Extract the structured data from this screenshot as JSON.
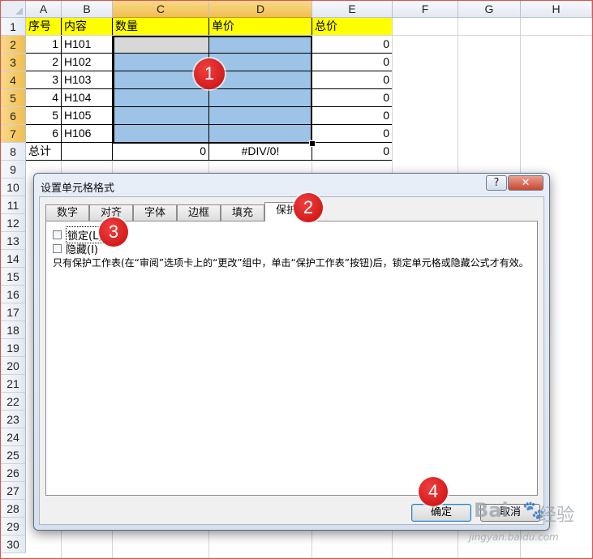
{
  "sheet": {
    "columns": [
      "A",
      "B",
      "C",
      "D",
      "E",
      "F",
      "G",
      "H"
    ],
    "rows": [
      "1",
      "2",
      "3",
      "4",
      "5",
      "6",
      "7",
      "8",
      "9",
      "10",
      "11",
      "12",
      "13",
      "14",
      "15",
      "16",
      "17",
      "18",
      "19",
      "20",
      "21",
      "22",
      "23",
      "24",
      "25",
      "26",
      "27",
      "28",
      "29",
      "30"
    ],
    "header": {
      "a": "序号",
      "b": "内容",
      "c": "数量",
      "d": "单价",
      "e": "总价"
    },
    "data": [
      {
        "a": "1",
        "b": "H101",
        "e": "0"
      },
      {
        "a": "2",
        "b": "H102",
        "e": "0"
      },
      {
        "a": "3",
        "b": "H103",
        "e": "0"
      },
      {
        "a": "4",
        "b": "H104",
        "e": "0"
      },
      {
        "a": "5",
        "b": "H105",
        "e": "0"
      },
      {
        "a": "6",
        "b": "H106",
        "e": "0"
      }
    ],
    "total": {
      "a": "总计",
      "c": "0",
      "d": "#DIV/0!",
      "e": "0"
    },
    "colors": {
      "header_fill": "#ffff00",
      "selection_fill": "#9dc3e6",
      "selected_header": "#f1be4e"
    }
  },
  "dialog": {
    "title": "设置单元格格式",
    "help_label": "?",
    "close_label": "✕",
    "tabs": [
      {
        "label": "数字",
        "active": false
      },
      {
        "label": "对齐",
        "active": false
      },
      {
        "label": "字体",
        "active": false
      },
      {
        "label": "边框",
        "active": false
      },
      {
        "label": "填充",
        "active": false
      },
      {
        "label": "保护",
        "active": true
      }
    ],
    "locked_label": "锁定(L)",
    "locked_checked": false,
    "hidden_label": "隐藏(I)",
    "hidden_checked": false,
    "note": "只有保护工作表(在“审阅”选项卡上的“更改”组中，单击“保护工作表”按钮)后，锁定单元格或隐藏公式才有效。",
    "ok_label": "确定",
    "cancel_label": "取消"
  },
  "markers": [
    "1",
    "2",
    "3",
    "4"
  ],
  "watermark": {
    "logo": "Bai",
    "brand": "经验",
    "url": "jingyan.baidu.com"
  }
}
